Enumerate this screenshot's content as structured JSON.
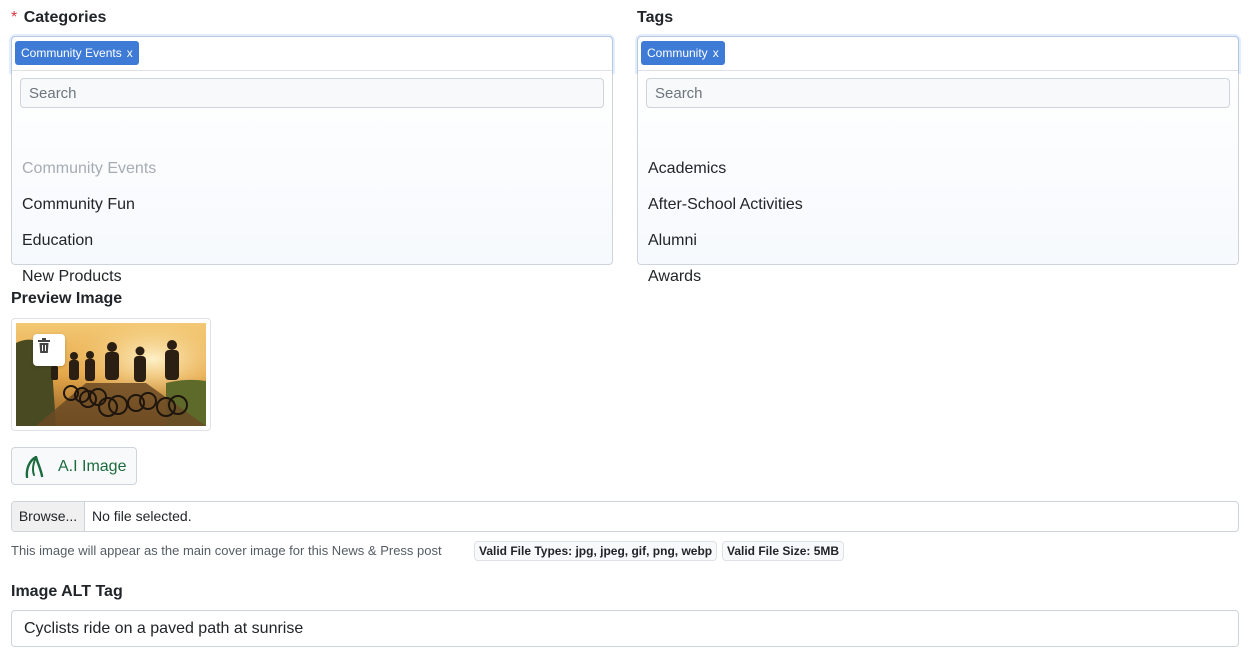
{
  "categories": {
    "required_mark": "*",
    "label": "Categories",
    "chip": {
      "text": "Community Events",
      "remove": "x"
    },
    "search_placeholder": "Search",
    "options": [
      {
        "label": "Community Events",
        "selected": true
      },
      {
        "label": "Community Fun",
        "selected": false
      },
      {
        "label": "Education",
        "selected": false
      },
      {
        "label": "New Products",
        "selected": false
      }
    ]
  },
  "tags": {
    "label": "Tags",
    "chip": {
      "text": "Community",
      "remove": "x"
    },
    "search_placeholder": "Search",
    "options": [
      {
        "label": "Academics"
      },
      {
        "label": "After-School Activities"
      },
      {
        "label": "Alumni"
      },
      {
        "label": "Awards"
      }
    ]
  },
  "preview": {
    "label": "Preview Image",
    "delete_icon": "trash-icon"
  },
  "ai_button": {
    "label": "A.I Image",
    "icon": "ai-leaf-icon"
  },
  "file_input": {
    "browse_label": "Browse...",
    "status": "No file selected."
  },
  "help": {
    "text": "This image will appear as the main cover image for this News & Press post",
    "badges": [
      "Valid File Types: jpg, jpeg, gif, png, webp",
      "Valid File Size: 5MB"
    ]
  },
  "alt_tag": {
    "label": "Image ALT Tag",
    "value": "Cyclists ride on a paved path at sunrise"
  },
  "colors": {
    "chip": "#3d7bd6",
    "required": "#dc3545",
    "ai_text": "#1c6b3f"
  }
}
